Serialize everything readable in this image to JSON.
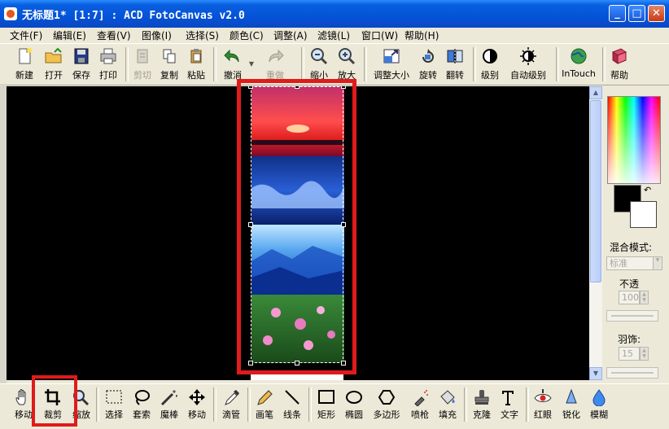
{
  "window": {
    "title": "无标题1* [1:7] : ACD FotoCanvas v2.0"
  },
  "menu": [
    "文件(F)",
    "编辑(E)",
    "查看(V)",
    "图像(I)",
    "选择(S)",
    "颜色(C)",
    "调整(A)",
    "滤镜(L)",
    "窗口(W)",
    "帮助(H)"
  ],
  "toolbar": {
    "new": "新建",
    "open": "打开",
    "save": "保存",
    "print": "打印",
    "cut": "剪切",
    "copy": "复制",
    "paste": "粘贴",
    "undo": "撤消",
    "redo": "重做",
    "zoom_out": "缩小",
    "zoom_in": "放大",
    "resize": "调整大小",
    "rotate": "旋转",
    "flip": "翻转",
    "levels": "级别",
    "auto_levels": "自动级别",
    "intouch": "InTouch",
    "help": "帮助"
  },
  "panel": {
    "blend_mode_label": "混合模式:",
    "blend_mode_value": "标准",
    "opacity_label": "不透",
    "opacity_value": "100",
    "feather_label": "羽饰:",
    "feather_value": "15"
  },
  "tools": {
    "move_view": "移动",
    "crop": "裁剪",
    "zoom": "缩放",
    "select": "选择",
    "lasso": "套索",
    "magic_wand": "魔棒",
    "move": "移动",
    "eyedropper": "滴管",
    "pencil": "画笔",
    "line": "线条",
    "rect": "矩形",
    "ellipse": "椭圆",
    "polygon": "多边形",
    "spray": "喷枪",
    "fill": "填充",
    "clone": "克隆",
    "text": "文字",
    "red_eye": "红眼",
    "sharpen": "锐化",
    "blur": "模糊"
  },
  "colors": {
    "highlight": "#e01b1b",
    "foreground": "#000000",
    "background": "#ffffff"
  }
}
